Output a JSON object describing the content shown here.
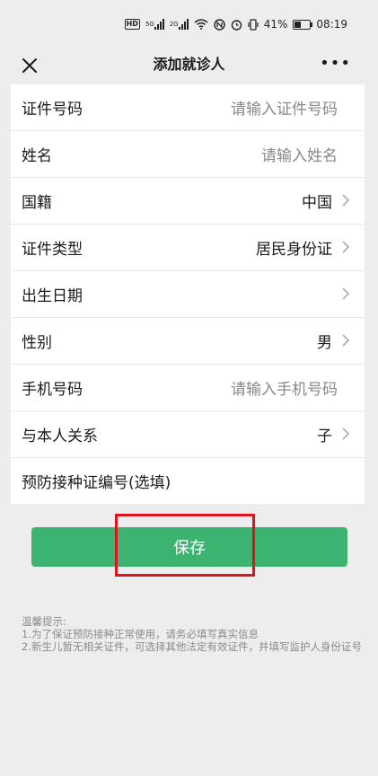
{
  "status_bar": {
    "battery": "41%",
    "time": "08:19",
    "network_5g": "5G",
    "network_2g": "2G",
    "hd": "HD"
  },
  "nav": {
    "title": "添加就诊人",
    "more": "•••"
  },
  "form": {
    "rows": [
      {
        "label": "证件号码",
        "placeholder": "请输入证件号码"
      },
      {
        "label": "姓名",
        "placeholder": "请输入姓名"
      },
      {
        "label": "国籍",
        "value": "中国"
      },
      {
        "label": "证件类型",
        "value": "居民身份证"
      },
      {
        "label": "出生日期",
        "value": ""
      },
      {
        "label": "性别",
        "value": "男"
      },
      {
        "label": "手机号码",
        "placeholder": "请输入手机号码"
      },
      {
        "label": "与本人关系",
        "value": "子"
      },
      {
        "label": "预防接种证编号(选填)"
      }
    ]
  },
  "save_button": {
    "label": "保存"
  },
  "tips": {
    "title": "温馨提示:",
    "line1": "1.为了保证预防接种正常使用，请务必填写真实信息",
    "line2": "2.新生儿暂无相关证件，可选择其他法定有效证件，并填写监护人身份证号"
  },
  "colors": {
    "accent": "#3cb370",
    "highlight": "#e0141e"
  }
}
